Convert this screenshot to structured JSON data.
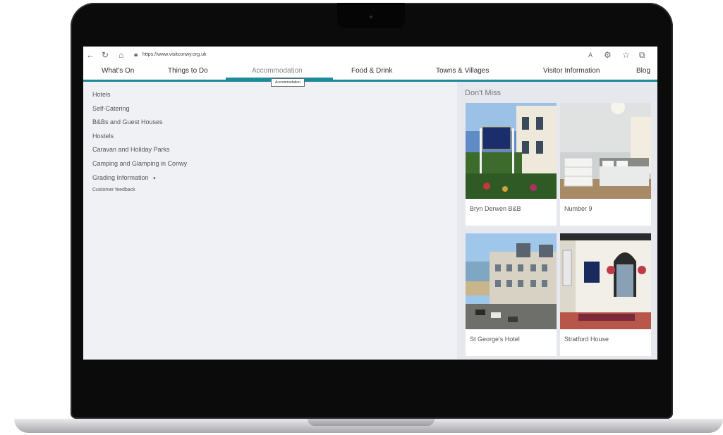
{
  "browser": {
    "url": "https://www.visitconwy.org.uk",
    "icons": [
      "back-icon",
      "refresh-icon",
      "home-icon",
      "lock-icon",
      "read-aloud-icon",
      "extensions-icon",
      "favorites-icon",
      "collections-icon"
    ]
  },
  "nav": {
    "items": [
      {
        "label": "What's On"
      },
      {
        "label": "Things to Do"
      },
      {
        "label": "Accommodation"
      },
      {
        "label": "Food & Drink"
      },
      {
        "label": "Towns & Villages"
      },
      {
        "label": "Visitor Information"
      },
      {
        "label": "Blog"
      }
    ],
    "active": "Accommodation",
    "tooltip": "Accommodation",
    "accent_color": "#1f8a9c"
  },
  "menu": {
    "items": [
      {
        "label": "Hotels"
      },
      {
        "label": "Self-Catering"
      },
      {
        "label": "B&Bs and Guest Houses"
      },
      {
        "label": "Hostels"
      },
      {
        "label": "Caravan and Holiday Parks"
      },
      {
        "label": "Camping and Glamping in Conwy"
      },
      {
        "label": "Grading Information",
        "caret": "▾"
      },
      {
        "label": "Customer feedback"
      }
    ]
  },
  "dont_miss": {
    "title": "Don't Miss",
    "cards": [
      {
        "label": "Bryn Derwen B&B"
      },
      {
        "label": "Number 9"
      },
      {
        "label": "St George's Hotel"
      },
      {
        "label": "Stratford House"
      }
    ]
  }
}
